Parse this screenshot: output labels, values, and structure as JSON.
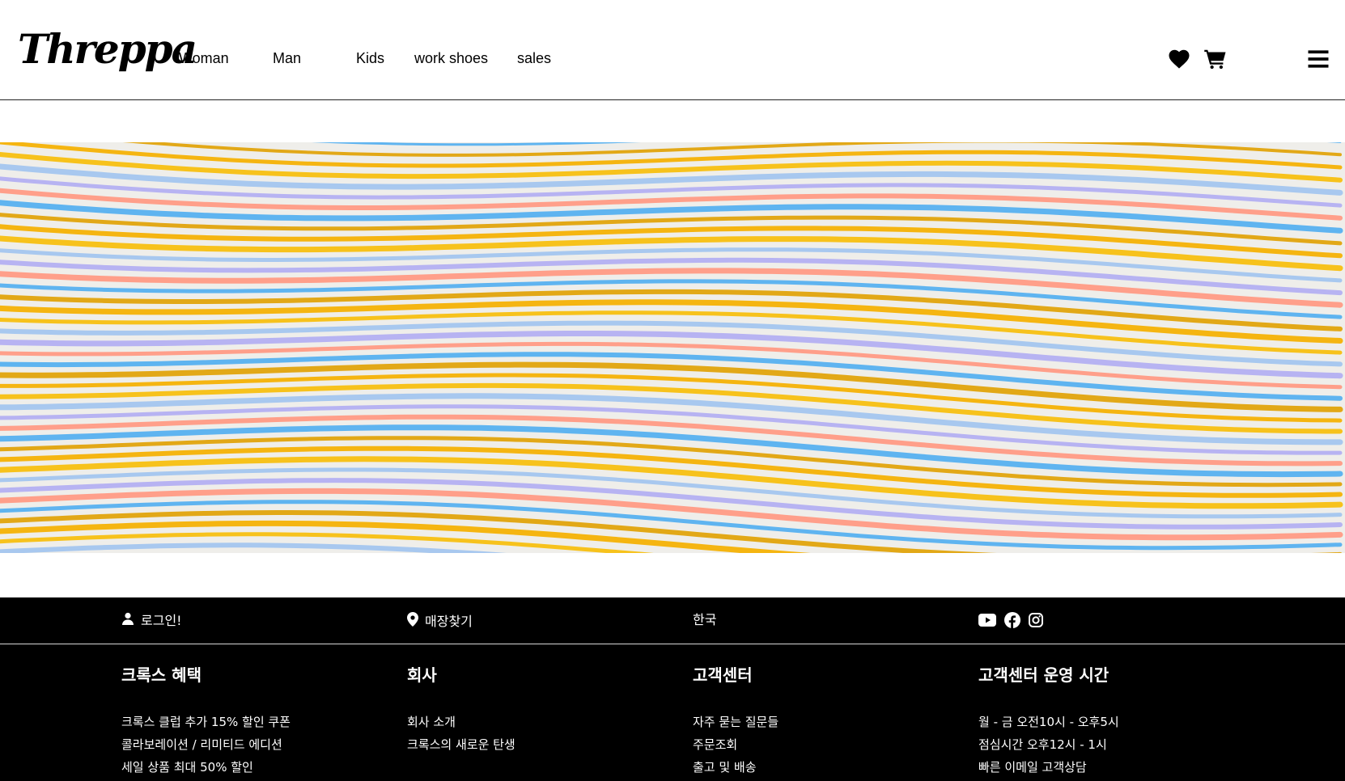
{
  "header": {
    "logo_text": "Threppa",
    "nav": [
      {
        "label": "Woman"
      },
      {
        "label": "Man"
      },
      {
        "label": "Kids"
      },
      {
        "label": "work shoes"
      },
      {
        "label": "sales"
      }
    ],
    "icons": [
      "heart-icon",
      "cart-icon",
      "menu-icon"
    ]
  },
  "banner": {
    "colors": [
      "#f5b511",
      "#f7c21c",
      "#a8c8ef",
      "#b7b3f2",
      "#ff9f8a",
      "#5fb4f0",
      "#e2a817"
    ]
  },
  "footer_bar": {
    "login_label": "로그인!",
    "store_label": "매장찾기",
    "language_label": "한국",
    "social_icons": [
      "youtube-icon",
      "facebook-icon",
      "instagram-icon"
    ]
  },
  "footer": {
    "columns": [
      {
        "title": "크록스 혜택",
        "links": [
          "크록스 클럽 추가 15% 할인 쿠폰",
          "콜라보레이션 / 리미티드 에디션",
          "세일 상품 최대 50% 할인"
        ]
      },
      {
        "title": "회사",
        "links": [
          "회사 소개",
          "크록스의 새로운 탄생"
        ]
      },
      {
        "title": "고객센터",
        "links": [
          "자주 묻는 질문들",
          "주문조회",
          "출고 및 배송"
        ]
      },
      {
        "title": "고객센터 운영 시간",
        "links": [
          "월 - 금 오전10시 - 오후5시",
          "점심시간 오후12시 - 1시",
          "빠른 이메일 고객상담"
        ]
      }
    ]
  }
}
